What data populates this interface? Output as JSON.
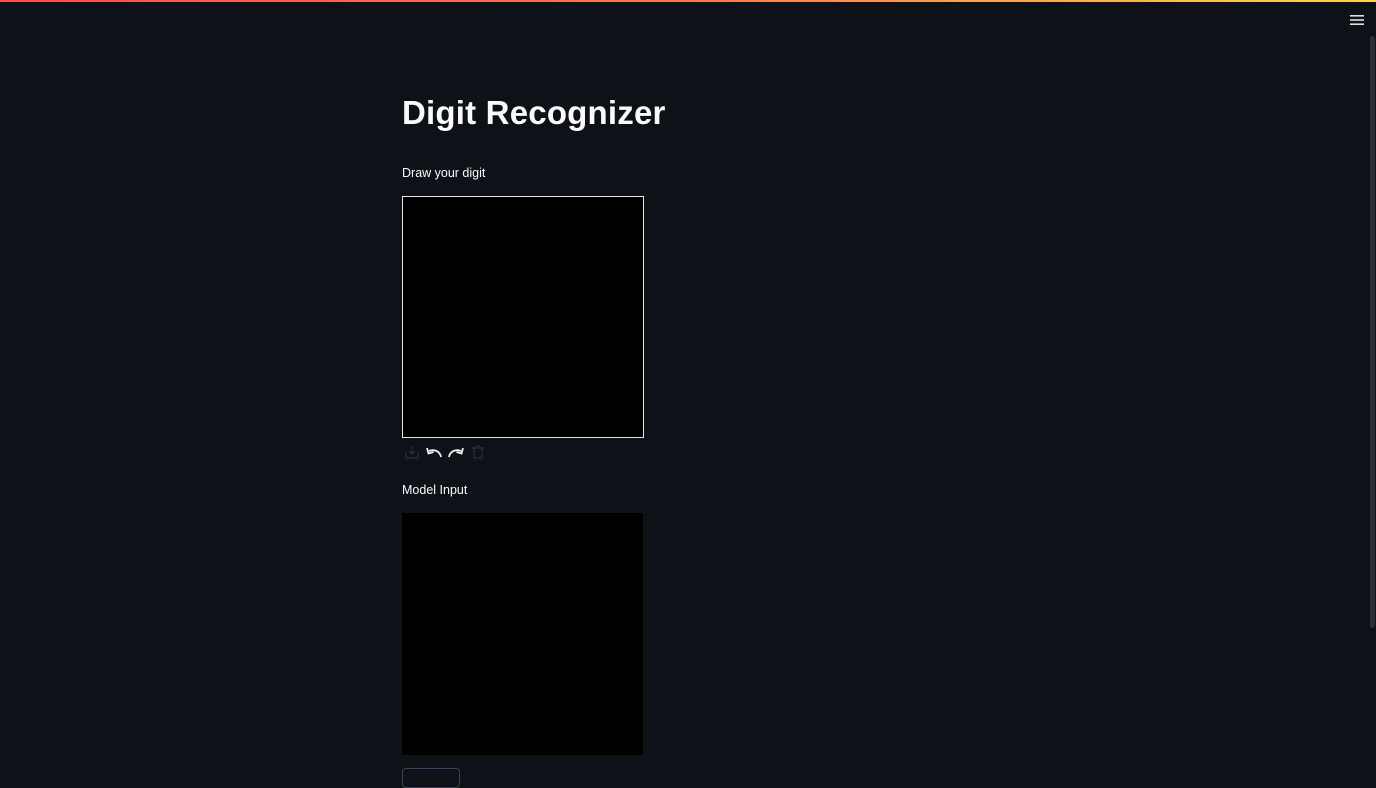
{
  "app": {
    "title": "Digit Recognizer"
  },
  "canvas_section": {
    "label": "Draw your digit"
  },
  "toolbar": {
    "icons": [
      "download-icon",
      "undo-icon",
      "redo-icon",
      "trash-icon"
    ]
  },
  "model_section": {
    "label": "Model Input"
  },
  "colors": {
    "background": "#0e1117",
    "text": "#fafafa",
    "accent_start": "#ff4b4b",
    "accent_end": "#ffd34d",
    "canvas": "#000000"
  }
}
